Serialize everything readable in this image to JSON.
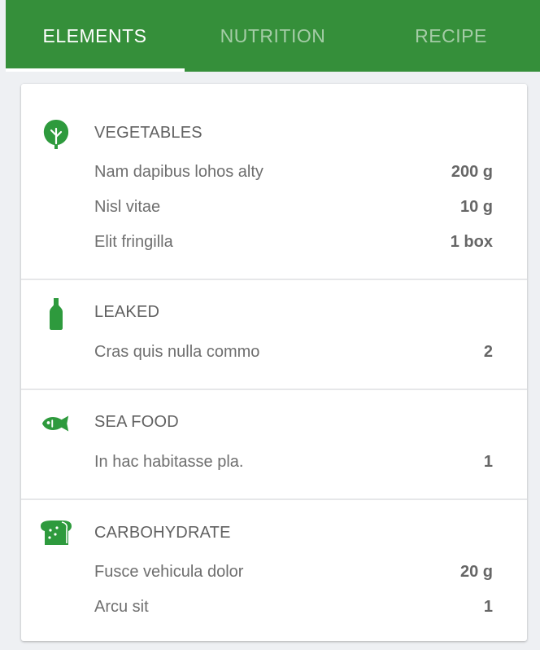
{
  "tabs": [
    {
      "label": "ELEMENTS"
    },
    {
      "label": "NUTRITION"
    },
    {
      "label": "RECIPE"
    }
  ],
  "active_tab": "ELEMENTS",
  "colors": {
    "accent": "#358f3a",
    "icon": "#2e9a3d"
  },
  "sections": [
    {
      "icon": "leaf-icon",
      "title": "VEGETABLES",
      "items": [
        {
          "name": "Nam dapibus lohos alty",
          "qty": "200 g"
        },
        {
          "name": "Nisl vitae",
          "qty": "10 g"
        },
        {
          "name": "Elit fringilla",
          "qty": "1 box"
        }
      ]
    },
    {
      "icon": "bottle-icon",
      "title": "LEAKED",
      "items": [
        {
          "name": "Cras quis nulla commo",
          "qty": "2"
        }
      ]
    },
    {
      "icon": "fish-icon",
      "title": "SEA FOOD",
      "items": [
        {
          "name": "In hac habitasse pla.",
          "qty": "1"
        }
      ]
    },
    {
      "icon": "bread-icon",
      "title": "CARBOHYDRATE",
      "items": [
        {
          "name": "Fusce vehicula dolor",
          "qty": "20 g"
        },
        {
          "name": "Arcu sit",
          "qty": "1"
        }
      ]
    }
  ]
}
